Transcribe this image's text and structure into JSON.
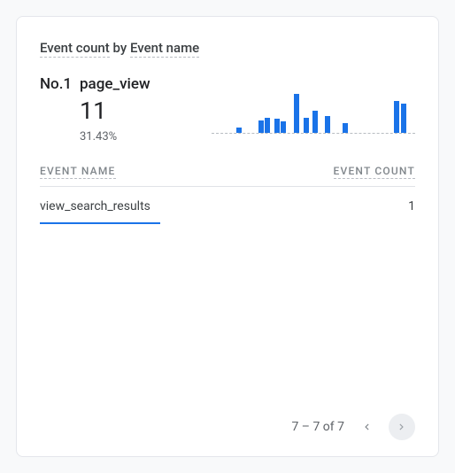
{
  "title": {
    "metric": "Event count",
    "by": "by",
    "dimension": "Event name"
  },
  "summary": {
    "rank_label": "No.1",
    "top_event": "page_view",
    "count": "11",
    "pct": "31.43%"
  },
  "chart_data": {
    "type": "bar",
    "title": "Event count sparkline",
    "values": [
      4,
      9,
      11,
      10,
      8,
      28,
      11,
      16,
      12,
      7,
      23,
      21
    ],
    "ylim": [
      0,
      28
    ],
    "xlabel": "",
    "ylabel": ""
  },
  "columns": {
    "name": "EVENT NAME",
    "count": "EVENT COUNT"
  },
  "rows": [
    {
      "name": "view_search_results",
      "count": "1"
    }
  ],
  "pager": {
    "text": "7 – 7 of 7",
    "prev_enabled": false,
    "next_enabled": true
  },
  "colors": {
    "accent": "#1a73e8"
  }
}
